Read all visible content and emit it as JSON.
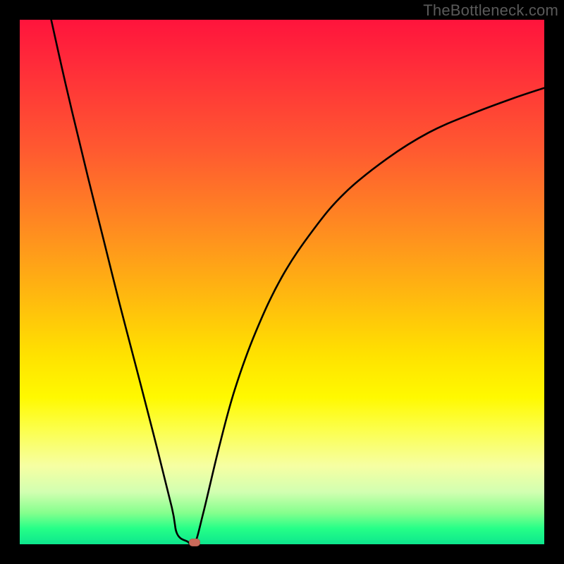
{
  "watermark": "TheBottleneck.com",
  "chart_data": {
    "type": "line",
    "title": "",
    "xlabel": "",
    "ylabel": "",
    "xlim": [
      0,
      1
    ],
    "ylim": [
      0,
      1
    ],
    "series": [
      {
        "name": "bottleneck-curve",
        "x": [
          0.06,
          0.08,
          0.1,
          0.13,
          0.16,
          0.19,
          0.22,
          0.255,
          0.29,
          0.3,
          0.32,
          0.333,
          0.35,
          0.38,
          0.41,
          0.45,
          0.5,
          0.56,
          0.62,
          0.7,
          0.78,
          0.86,
          0.94,
          1.0
        ],
        "values": [
          1.0,
          0.91,
          0.824,
          0.7,
          0.58,
          0.46,
          0.345,
          0.21,
          0.07,
          0.02,
          0.005,
          0.0,
          0.06,
          0.185,
          0.295,
          0.405,
          0.51,
          0.6,
          0.67,
          0.735,
          0.785,
          0.82,
          0.85,
          0.87
        ]
      }
    ],
    "marker": {
      "x": 0.333,
      "y": 0.003,
      "label": ""
    }
  },
  "colors": {
    "curve": "#000000",
    "marker": "#c96a5a",
    "gradient_top": "#ff143c",
    "gradient_mid": "#ffe200",
    "gradient_bottom": "#00e58a"
  }
}
